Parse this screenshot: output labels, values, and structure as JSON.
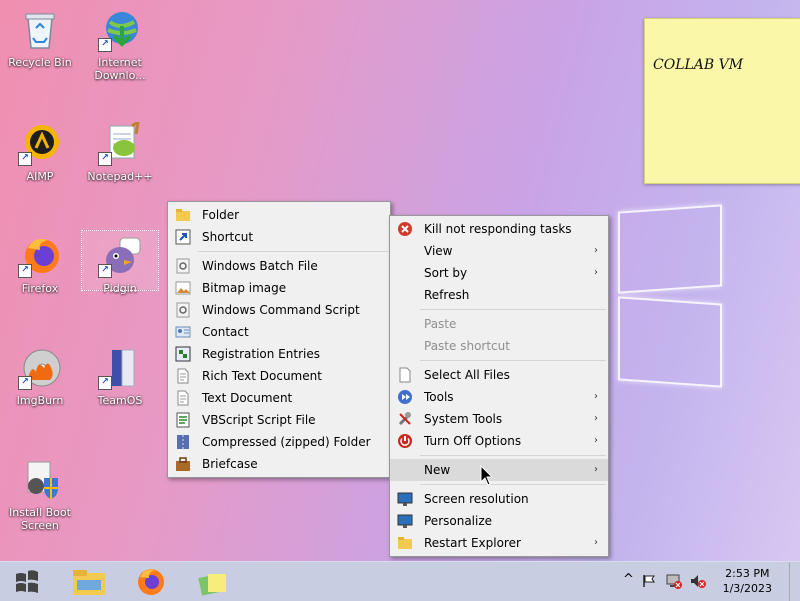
{
  "desktop": {
    "icons": [
      {
        "label": "Recycle Bin"
      },
      {
        "label": "Internet Downlo..."
      },
      {
        "label": "AIMP"
      },
      {
        "label": "Notepad++"
      },
      {
        "label": "Firefox"
      },
      {
        "label": "Pidgin"
      },
      {
        "label": "ImgBurn"
      },
      {
        "label": "TeamOS"
      },
      {
        "label": "Install Boot Screen"
      }
    ],
    "sticky_note": "COLLAB VM"
  },
  "context_menu": {
    "items": [
      {
        "label": "Kill not responding tasks",
        "icon": "stop-red-icon"
      },
      {
        "label": "View",
        "submenu": true
      },
      {
        "label": "Sort by",
        "submenu": true
      },
      {
        "label": "Refresh"
      },
      {
        "label": "Paste",
        "disabled": true
      },
      {
        "label": "Paste shortcut",
        "disabled": true
      },
      {
        "label": "Select All Files",
        "icon": "file-icon"
      },
      {
        "label": "Tools",
        "icon": "tools-arrow-icon",
        "submenu": true
      },
      {
        "label": "System Tools",
        "icon": "wrench-icon",
        "submenu": true
      },
      {
        "label": "Turn Off Options",
        "icon": "power-icon",
        "submenu": true
      },
      {
        "label": "New",
        "submenu": true,
        "highlighted": true
      },
      {
        "label": "Screen resolution",
        "icon": "monitor-icon"
      },
      {
        "label": "Personalize",
        "icon": "monitor-icon"
      },
      {
        "label": "Restart Explorer",
        "icon": "folder-icon",
        "submenu": true
      }
    ],
    "submenu_arrow": "›"
  },
  "new_submenu": {
    "items": [
      {
        "label": "Folder",
        "icon": "folder-icon"
      },
      {
        "label": "Shortcut",
        "icon": "shortcut-icon"
      },
      {
        "label": "Windows Batch File",
        "icon": "gear-file-icon"
      },
      {
        "label": "Bitmap image",
        "icon": "image-icon"
      },
      {
        "label": "Windows Command Script",
        "icon": "gear-file-icon"
      },
      {
        "label": "Contact",
        "icon": "contact-icon"
      },
      {
        "label": "Registration Entries",
        "icon": "registry-icon"
      },
      {
        "label": "Rich Text Document",
        "icon": "document-icon"
      },
      {
        "label": "Text Document",
        "icon": "document-icon"
      },
      {
        "label": "VBScript Script File",
        "icon": "script-icon"
      },
      {
        "label": "Compressed (zipped) Folder",
        "icon": "zip-icon"
      },
      {
        "label": "Briefcase",
        "icon": "briefcase-icon"
      }
    ]
  },
  "taskbar": {
    "clock_time": "2:53 PM",
    "clock_date": "1/3/2023",
    "tray_chevron": "^"
  }
}
